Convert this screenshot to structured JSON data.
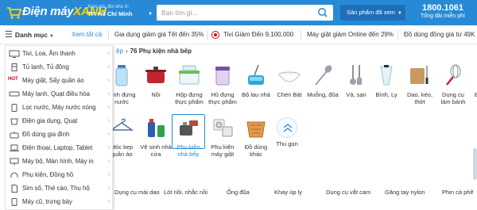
{
  "header": {
    "logo_main": "Điện máy",
    "logo_accent": "XANH",
    "location_hint": "Xem giá, tồn kho ở:",
    "location_city": "TP. Hồ Chí Minh",
    "search_placeholder": "Bạn tìm gì...",
    "viewed_label": "Sản phẩm đã xem",
    "hotline_number": "1800.1061",
    "hotline_note": "Tổng đài miễn phí",
    "brand_color": "#288ad6",
    "accent_color": "#ffd400"
  },
  "catbar": {
    "menu_label": "Danh mục",
    "see_all": "Xem tất cả",
    "promos": [
      "Gia dụng giảm giá Tết đến 35%",
      "Tivi Giảm Đến 9,100,000",
      "Máy giặt giảm Online đến 29%",
      "Đồ dùng đồng giá từ 49K"
    ]
  },
  "sidemenu": {
    "hot_badge": "HOT",
    "items": [
      {
        "label": "Tivi, Loa, Âm thanh",
        "icon": "tv-icon"
      },
      {
        "label": "Tủ lạnh, Tủ đông",
        "icon": "fridge-icon"
      },
      {
        "label": "Máy giặt, Sấy quần áo",
        "icon": "washer-icon"
      },
      {
        "label": "Máy lạnh, Quạt điều hòa",
        "icon": "air-conditioner-icon"
      },
      {
        "label": "Lọc nước, Máy nước nóng",
        "icon": "water-filter-icon"
      },
      {
        "label": "Điện gia dụng, Quạt",
        "icon": "appliance-icon"
      },
      {
        "label": "Đồ dùng gia đình",
        "icon": "household-icon"
      },
      {
        "label": "Điện thoại, Laptop, Tablet",
        "icon": "laptop-icon"
      },
      {
        "label": "Máy bộ, Màn hình, Máy in",
        "icon": "monitor-icon"
      },
      {
        "label": "Phụ kiện, Đồng hồ",
        "icon": "headphone-icon"
      },
      {
        "label": "Sim số, Thẻ cào, Thu hộ",
        "icon": "sim-icon"
      },
      {
        "label": "Máy cũ, trưng bày",
        "icon": "old-device-icon"
      }
    ]
  },
  "breadcrumb": {
    "parent": "ệp",
    "separator": "›",
    "count": "76",
    "current": "Phụ kiện nhà bếp"
  },
  "categories": {
    "row1": [
      {
        "label": "Bình đựng nước",
        "icon": "water-bottle-icon"
      },
      {
        "label": "Nồi",
        "icon": "pot-icon"
      },
      {
        "label": "Hộp đựng thực phẩm",
        "icon": "food-box-icon"
      },
      {
        "label": "Hũ đựng thực phẩm",
        "icon": "jar-icon"
      },
      {
        "label": "Bộ lau nhà",
        "icon": "mop-icon"
      },
      {
        "label": "Chén Bát",
        "icon": "bowl-icon"
      },
      {
        "label": "Muỗng, đũa",
        "icon": "spoon-icon"
      },
      {
        "label": "Vá, sạn",
        "icon": "ladle-icon"
      },
      {
        "label": "Bình, Ly",
        "icon": "glass-icon"
      },
      {
        "label": "Dao, kéo, thớt",
        "icon": "knife-icon"
      },
      {
        "label": "Dụng cụ làm bánh",
        "icon": "whisk-icon"
      },
      {
        "label": "Bình giữ nh...",
        "icon": "thermos-icon"
      }
    ],
    "row2": [
      {
        "label": "Móc kẹp quần áo",
        "icon": "hanger-icon"
      },
      {
        "label": "Vệ sinh nhà cửa",
        "icon": "cleaning-icon"
      },
      {
        "label": "Phụ kiện nhà bếp",
        "icon": "kitchen-accessory-icon",
        "active": true
      },
      {
        "label": "Phụ kiện máy giặt",
        "icon": "washer-accessory-icon"
      },
      {
        "label": "Đồ dùng khác",
        "icon": "basket-icon"
      },
      {
        "label": "Thu gọn",
        "icon": "collapse-icon"
      }
    ]
  },
  "subcategories": [
    "Dụng cụ mài dao",
    "Lót nồi, nhắc nồi",
    "Ống đũa",
    "Khay úp ly",
    "Dụng cụ vắt cam",
    "Găng tay nylon",
    "Phin cà phê"
  ]
}
